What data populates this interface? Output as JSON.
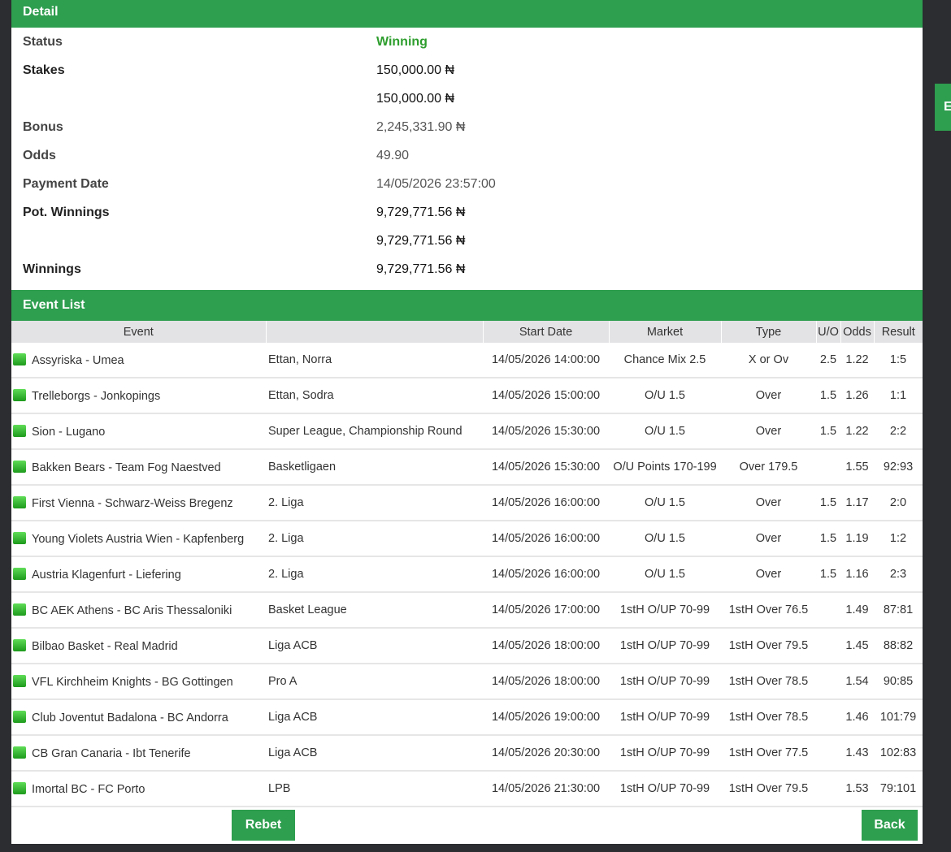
{
  "detail": {
    "title": "Detail",
    "rows": [
      {
        "label": "Status",
        "value": "Winning"
      },
      {
        "label": "Stakes",
        "value": "150,000.00 ₦"
      },
      {
        "label": "",
        "value": "150,000.00 ₦"
      },
      {
        "label": "Bonus",
        "value": "2,245,331.90 ₦"
      },
      {
        "label": "Odds",
        "value": "49.90"
      },
      {
        "label": "Payment Date",
        "value": "14/05/2026 23:57:00"
      },
      {
        "label": "Pot. Winnings",
        "value": "9,729,771.56 ₦"
      },
      {
        "label": "",
        "value": "9,729,771.56 ₦"
      },
      {
        "label": "Winnings",
        "value": "9,729,771.56 ₦"
      }
    ]
  },
  "event_list": {
    "title": "Event List",
    "columns": [
      "Event",
      "",
      "Start Date",
      "Market",
      "Type",
      "U/O",
      "Odds",
      "Result"
    ],
    "rows": [
      [
        "Assyriska - Umea",
        "Ettan, Norra",
        "14/05/2026 14:00:00",
        "Chance Mix 2.5",
        "X or Ov",
        "2.5",
        "1.22",
        "1:5"
      ],
      [
        "Trelleborgs - Jonkopings",
        "Ettan, Sodra",
        "14/05/2026 15:00:00",
        "O/U 1.5",
        "Over",
        "1.5",
        "1.26",
        "1:1"
      ],
      [
        "Sion - Lugano",
        "Super League, Championship Round",
        "14/05/2026 15:30:00",
        "O/U 1.5",
        "Over",
        "1.5",
        "1.22",
        "2:2"
      ],
      [
        "Bakken Bears - Team Fog Naestved",
        "Basketligaen",
        "14/05/2026 15:30:00",
        "O/U Points 170-199",
        "Over 179.5",
        "",
        "1.55",
        "92:93"
      ],
      [
        "First Vienna - Schwarz-Weiss Bregenz",
        "2. Liga",
        "14/05/2026 16:00:00",
        "O/U 1.5",
        "Over",
        "1.5",
        "1.17",
        "2:0"
      ],
      [
        "Young Violets Austria Wien - Kapfenberg",
        "2. Liga",
        "14/05/2026 16:00:00",
        "O/U 1.5",
        "Over",
        "1.5",
        "1.19",
        "1:2"
      ],
      [
        "Austria Klagenfurt - Liefering",
        "2. Liga",
        "14/05/2026 16:00:00",
        "O/U 1.5",
        "Over",
        "1.5",
        "1.16",
        "2:3"
      ],
      [
        "BC AEK Athens - BC Aris Thessaloniki",
        "Basket League",
        "14/05/2026 17:00:00",
        "1stH O/UP 70-99",
        "1stH Over 76.5",
        "",
        "1.49",
        "87:81"
      ],
      [
        "Bilbao Basket - Real Madrid",
        "Liga ACB",
        "14/05/2026 18:00:00",
        "1stH O/UP 70-99",
        "1stH Over 79.5",
        "",
        "1.45",
        "88:82"
      ],
      [
        "VFL Kirchheim Knights - BG Gottingen",
        "Pro A",
        "14/05/2026 18:00:00",
        "1stH O/UP 70-99",
        "1stH Over 78.5",
        "",
        "1.54",
        "90:85"
      ],
      [
        "Club Joventut Badalona - BC Andorra",
        "Liga ACB",
        "14/05/2026 19:00:00",
        "1stH O/UP 70-99",
        "1stH Over 78.5",
        "",
        "1.46",
        "101:79"
      ],
      [
        "CB Gran Canaria - Ibt Tenerife",
        "Liga ACB",
        "14/05/2026 20:30:00",
        "1stH O/UP 70-99",
        "1stH Over 77.5",
        "",
        "1.43",
        "102:83"
      ],
      [
        "Imortal BC - FC Porto",
        "LPB",
        "14/05/2026 21:30:00",
        "1stH O/UP 70-99",
        "1stH Over 79.5",
        "",
        "1.53",
        "79:101"
      ]
    ]
  },
  "buttons": {
    "rebet": "Rebet",
    "back": "Back"
  },
  "side_tab": {
    "label": "E"
  },
  "colors": {
    "accent": "#2e9e4f",
    "status_win": "#2e9e2e",
    "background": "#2b2d30"
  },
  "icons": {
    "event_status": "green-square-icon"
  }
}
